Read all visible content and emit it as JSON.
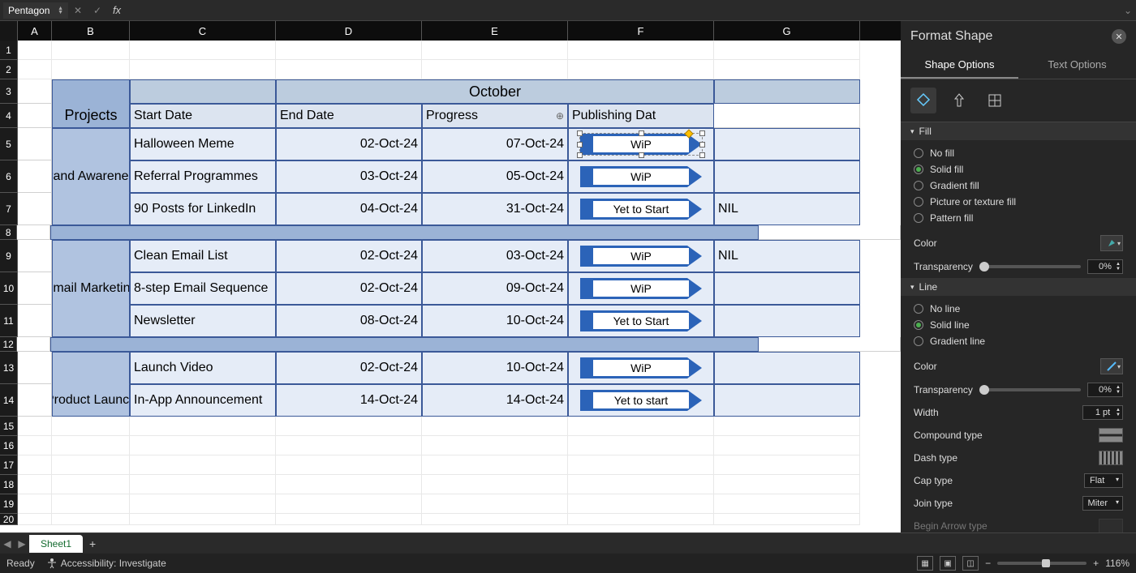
{
  "name_box": "Pentagon",
  "formula": "",
  "columns": [
    "A",
    "B",
    "C",
    "D",
    "E",
    "F",
    "G"
  ],
  "row_headers": [
    1,
    2,
    3,
    4,
    5,
    6,
    7,
    8,
    9,
    10,
    11,
    12,
    13,
    14,
    15,
    16,
    17,
    18,
    19,
    20
  ],
  "table": {
    "projects_hdr": "Projects",
    "month": "October",
    "cols": {
      "start": "Start Date",
      "end": "End Date",
      "progress": "Progress",
      "publish": "Publishing Dat"
    },
    "sections": [
      {
        "name": "Brand Awareness",
        "rows": [
          {
            "task": "Halloween Meme",
            "start": "02-Oct-24",
            "end": "07-Oct-24",
            "progress": "WiP",
            "publish": "",
            "selected": true
          },
          {
            "task": "Referral Programmes",
            "start": "03-Oct-24",
            "end": "05-Oct-24",
            "progress": "WiP",
            "publish": ""
          },
          {
            "task": "90 Posts for LinkedIn",
            "start": "04-Oct-24",
            "end": "31-Oct-24",
            "progress": "Yet to Start",
            "publish": "NIL"
          }
        ]
      },
      {
        "name": "Email Marketing",
        "rows": [
          {
            "task": "Clean Email List",
            "start": "02-Oct-24",
            "end": "03-Oct-24",
            "progress": "WiP",
            "publish": "NIL"
          },
          {
            "task": "8-step Email Sequence",
            "start": "02-Oct-24",
            "end": "09-Oct-24",
            "progress": "WiP",
            "publish": ""
          },
          {
            "task": "Newsletter",
            "start": "08-Oct-24",
            "end": "10-Oct-24",
            "progress": "Yet to Start",
            "publish": ""
          }
        ]
      },
      {
        "name": "Product Launch",
        "rows": [
          {
            "task": "Launch Video",
            "start": "02-Oct-24",
            "end": "10-Oct-24",
            "progress": "WiP",
            "publish": ""
          },
          {
            "task": "In-App Announcement",
            "start": "14-Oct-24",
            "end": "14-Oct-24",
            "progress": "Yet to start",
            "publish": ""
          }
        ]
      }
    ]
  },
  "panel": {
    "title": "Format Shape",
    "tabs": {
      "shape": "Shape Options",
      "text": "Text Options"
    },
    "fill": {
      "label": "Fill",
      "opts": [
        "No fill",
        "Solid fill",
        "Gradient fill",
        "Picture or texture fill",
        "Pattern fill"
      ],
      "selected": "Solid fill",
      "color_label": "Color",
      "trans_label": "Transparency",
      "trans_val": "0%"
    },
    "line": {
      "label": "Line",
      "opts": [
        "No line",
        "Solid line",
        "Gradient line"
      ],
      "selected": "Solid line",
      "color_label": "Color",
      "trans_label": "Transparency",
      "trans_val": "0%",
      "width_label": "Width",
      "width_val": "1 pt",
      "compound_label": "Compound type",
      "dash_label": "Dash type",
      "cap_label": "Cap type",
      "cap_val": "Flat",
      "join_label": "Join type",
      "join_val": "Miter",
      "begin_arrow_label": "Begin Arrow type"
    }
  },
  "sheet_tab": "Sheet1",
  "status": {
    "ready": "Ready",
    "accessibility": "Accessibility: Investigate",
    "zoom": "116%"
  }
}
